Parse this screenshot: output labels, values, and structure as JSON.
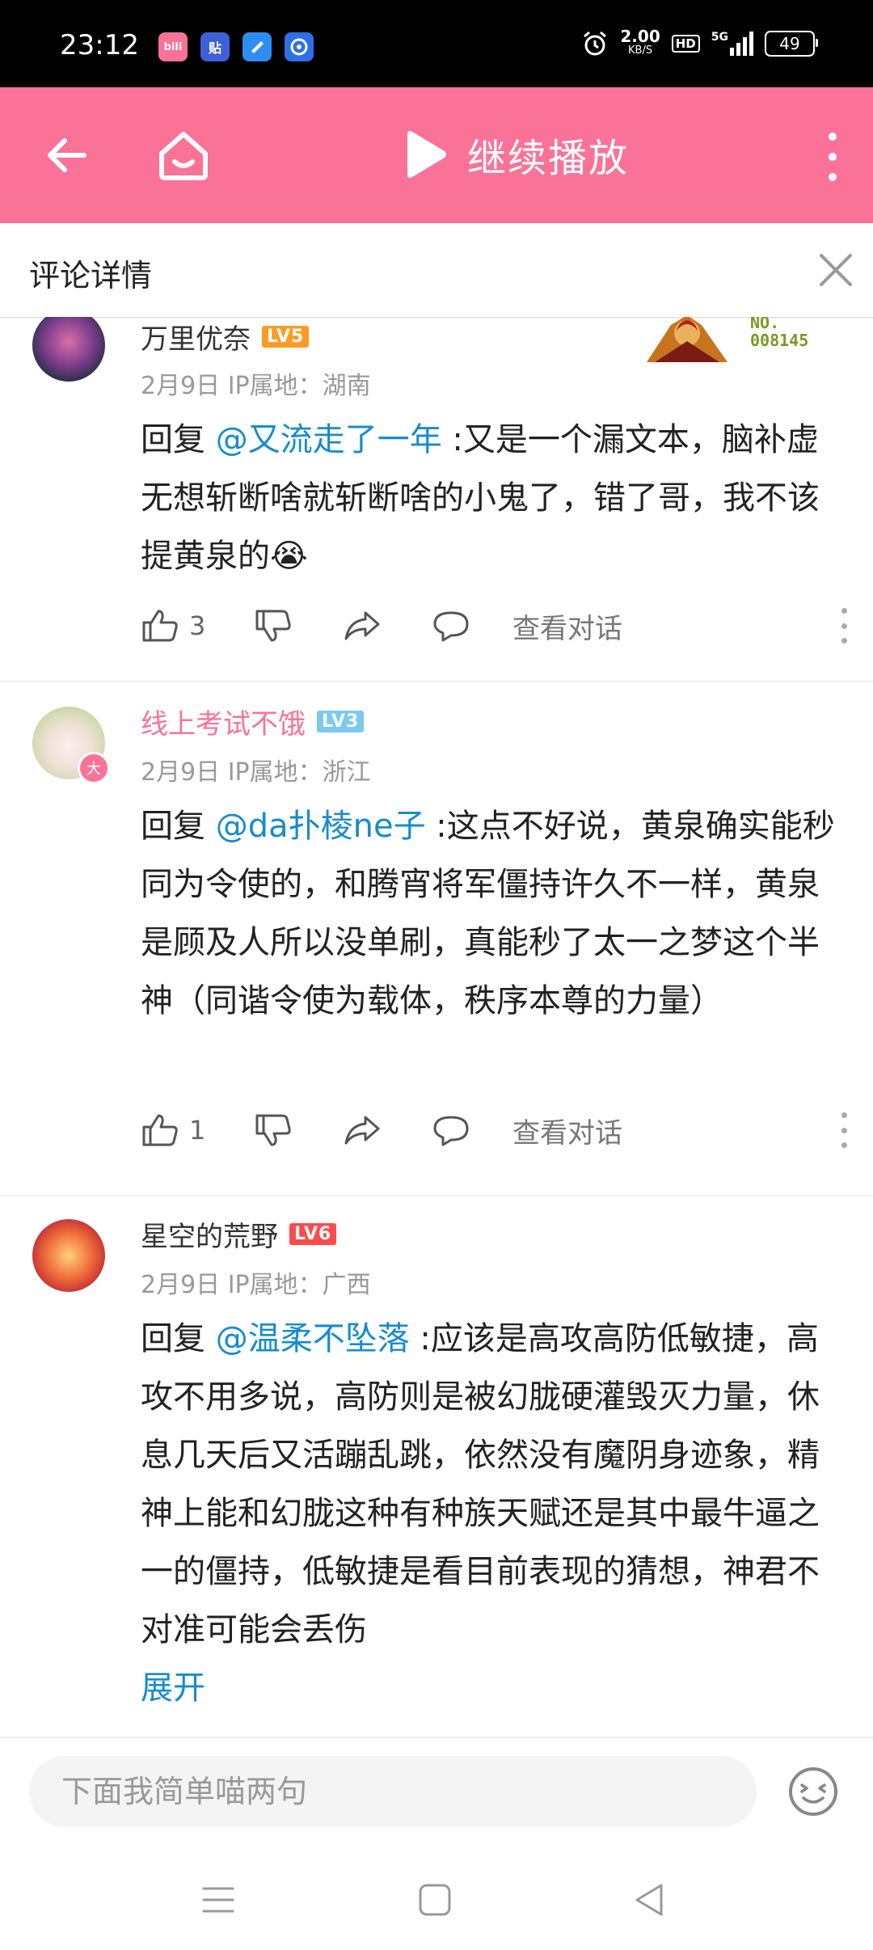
{
  "status_bar": {
    "time": "23:12",
    "apps": [
      {
        "name": "bilibili-app-icon",
        "text": "bili",
        "color": "#fb7299"
      },
      {
        "name": "tieba-app-icon",
        "text": "贴",
        "color": "#3f5fd9"
      },
      {
        "name": "docs-app-icon",
        "text": "",
        "color": "#2f8cf0"
      },
      {
        "name": "browser-app-icon",
        "text": "",
        "color": "#2f6fe8"
      }
    ],
    "net_speed_value": "2.00",
    "net_speed_unit": "KB/S",
    "hd": "HD",
    "network": "5G",
    "battery": "49"
  },
  "top_nav": {
    "play_label": "继续播放"
  },
  "detail_header": {
    "title": "评论详情"
  },
  "comments": [
    {
      "user": "万里优奈",
      "level": "LV5",
      "level_color": "#ff9b24",
      "meta": "2月9日 IP属地：湖南",
      "reply_prefix": "回复 ",
      "mention": "@又流走了一年",
      "text": " :又是一个漏文本，脑补虚无想斩断啥就斩断啥的小鬼了，错了哥，我不该提黄泉的",
      "emoji": "😭",
      "likes": "3",
      "view_dialog": "查看对话",
      "fan_badge_label": "NO.",
      "fan_badge_number": "008145"
    },
    {
      "user": "线上考试不饿",
      "level": "LV3",
      "level_color": "#7bc9ee",
      "meta": "2月9日 IP属地：浙江",
      "reply_prefix": "回复 ",
      "mention": "@da扑棱ne子",
      "text": " :这点不好说，黄泉确实能秒同为令使的，和腾宵将军僵持许久不一样，黄泉是顾及人所以没单刷，真能秒了太一之梦这个半神（同谐令使为载体，秩序本尊的力量）",
      "likes": "1",
      "view_dialog": "查看对话",
      "avatar_badge": "大"
    },
    {
      "user": "星空的荒野",
      "level": "LV6",
      "level_color": "#ff4b4b",
      "meta": "2月9日 IP属地：广西",
      "reply_prefix": "回复 ",
      "mention": "@温柔不坠落",
      "text": " :应该是高攻高防低敏捷，高攻不用多说，高防则是被幻胧硬灌毁灭力量，休息几天后又活蹦乱跳，依然没有魔阴身迹象，精神上能和幻胧这种有种族天赋还是其中最牛逼之一的僵持，低敏捷是看目前表现的猜想，神君不对准可能会丢伤",
      "expand": "展开"
    }
  ],
  "bottom_bar": {
    "placeholder": "下面我简单喵两句"
  },
  "colors": {
    "accent_pink": "#fb7299",
    "link_blue": "#178bcf"
  }
}
